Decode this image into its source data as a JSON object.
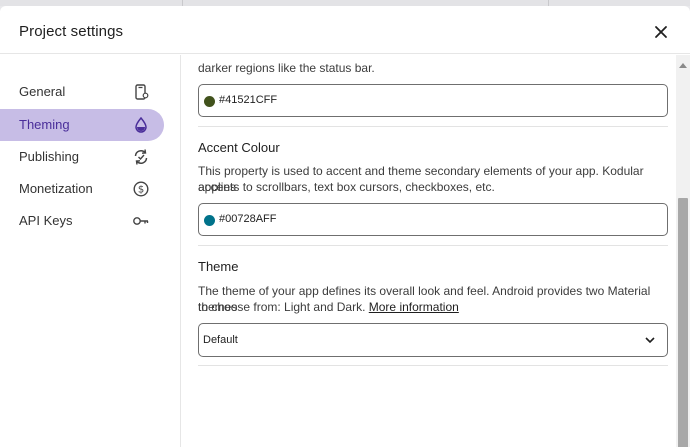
{
  "dialog": {
    "title": "Project settings",
    "close_icon": "close-icon"
  },
  "sidebar": {
    "items": [
      {
        "label": "General",
        "icon": "phone-settings-icon",
        "active": false
      },
      {
        "label": "Theming",
        "icon": "droplet-icon",
        "active": true
      },
      {
        "label": "Publishing",
        "icon": "sync-icon",
        "active": false
      },
      {
        "label": "Monetization",
        "icon": "dollar-circle-icon",
        "active": false
      },
      {
        "label": "API Keys",
        "icon": "key-icon",
        "active": false
      }
    ]
  },
  "theming": {
    "primary_dark": {
      "description_tail": "darker regions like the status bar.",
      "value": "#41521CFF",
      "swatch_color": "#41521C"
    },
    "accent": {
      "title": "Accent Colour",
      "description_line1": "This property is used to accent and theme secondary elements of your app. Kodular applies",
      "description_line2": "accents to scrollbars, text box cursors, checkboxes, etc.",
      "value": "#00728AFF",
      "swatch_color": "#00728A"
    },
    "theme": {
      "title": "Theme",
      "description_line1": "The theme of your app defines its overall look and feel. Android provides two Material themes",
      "description_line2_prefix": "to choose from: Light and Dark.",
      "more_link": "More information",
      "selected": "Default"
    }
  },
  "colors": {
    "active_bg": "#C7BDE6",
    "active_text": "#4A2E9A"
  }
}
